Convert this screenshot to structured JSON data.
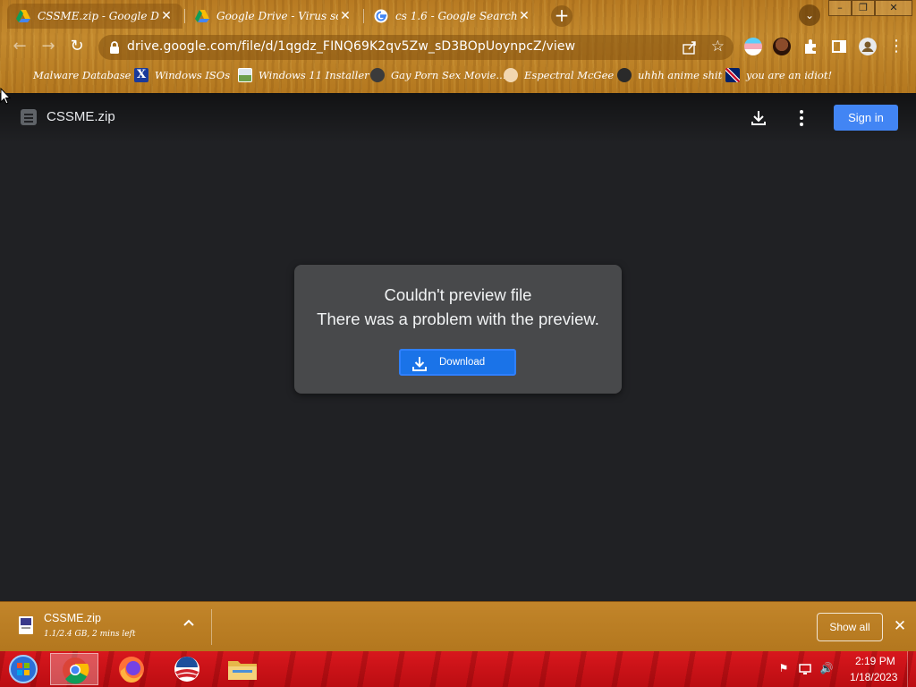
{
  "browser": {
    "tabs": [
      {
        "title": "CSSME.zip - Google Drive",
        "icon": "google-drive-icon",
        "active": true
      },
      {
        "title": "Google Drive - Virus scan warning",
        "icon": "google-drive-icon",
        "active": false
      },
      {
        "title": "cs 1.6 - Google Search",
        "icon": "google-icon",
        "active": false
      }
    ],
    "new_tab": "+",
    "tab_search": "⌄",
    "window_controls": {
      "minimize": "–",
      "restore": "❐",
      "close": "✕"
    },
    "url": "drive.google.com/file/d/1qgdz_FINQ69K2qv5Zw_sD3BOpUoynpcZ/view",
    "bookmarks": [
      {
        "label": "Malware Database",
        "icon": "folder-icon"
      },
      {
        "label": "Windows ISOs",
        "icon": "x-logo-icon"
      },
      {
        "label": "Windows 11 Installer",
        "icon": "image-icon"
      },
      {
        "label": "Gay Porn Sex Movie...",
        "icon": "site-icon"
      },
      {
        "label": "Espectral McGee",
        "icon": "face-icon"
      },
      {
        "label": "uhhh anime shit",
        "icon": "anime-icon"
      },
      {
        "label": "you are an idiot!",
        "icon": "flag-icon"
      }
    ]
  },
  "viewer": {
    "file_name": "CSSME.zip",
    "sign_in": "Sign in",
    "error_title": "Couldn't preview file",
    "error_body": "There was a problem with the preview.",
    "download_label": "Download"
  },
  "shelf": {
    "file_name": "CSSME.zip",
    "status": "1.1/2.4 GB, 2 mins left",
    "show_all": "Show all",
    "close": "✕"
  },
  "taskbar": {
    "time": "2:19 PM",
    "date": "1/18/2023"
  },
  "colors": {
    "accent": "#4285f4",
    "download_button": "#1a73e8",
    "viewer_bg": "#202124",
    "chrome_theme": "#c48a2e",
    "taskbar": "#d8171d"
  }
}
